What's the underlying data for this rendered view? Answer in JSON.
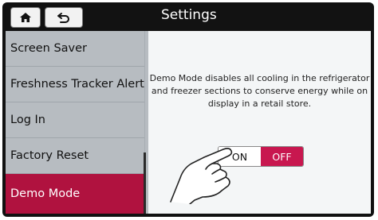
{
  "header": {
    "title": "Settings",
    "home_icon": "home-icon",
    "back_icon": "back-arrow-icon"
  },
  "sidebar": {
    "items": [
      {
        "label": "Screen Saver",
        "selected": false
      },
      {
        "label": "Freshness Tracker Alert",
        "selected": false
      },
      {
        "label": "Log In",
        "selected": false
      },
      {
        "label": "Factory Reset",
        "selected": false
      },
      {
        "label": "Demo Mode",
        "selected": true
      }
    ]
  },
  "content": {
    "description": "Demo Mode disables all cooling in the refrigerator and freezer sections to conserve energy while on display in a retail store.",
    "toggle": {
      "on_label": "ON",
      "off_label": "OFF",
      "selected": "OFF"
    }
  },
  "colors": {
    "accent": "#c8174f",
    "active_item": "#b0123f",
    "sidebar_bg": "#b7bcc1",
    "header_bg": "#121212"
  }
}
